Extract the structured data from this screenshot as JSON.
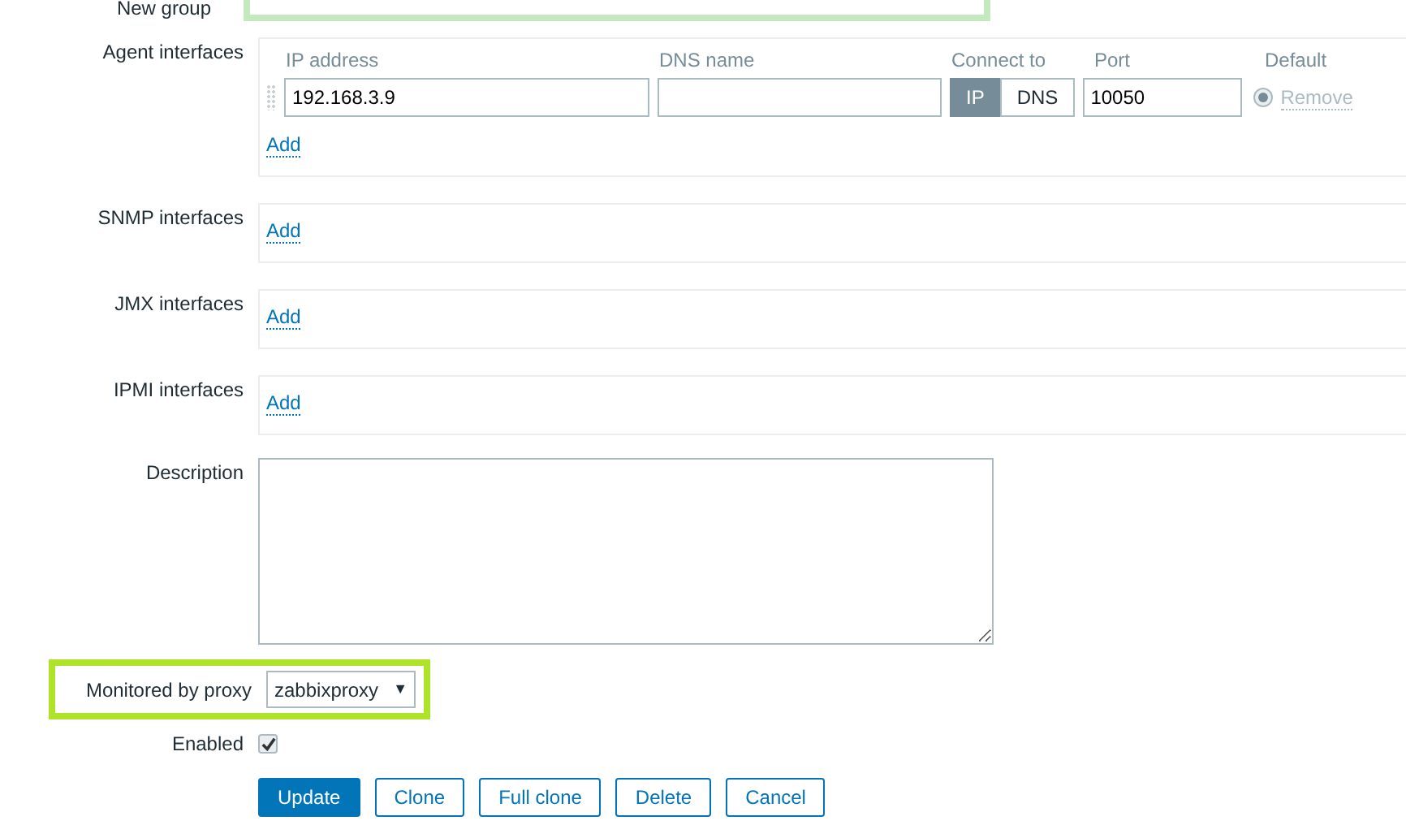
{
  "new_group": {
    "label": "New group"
  },
  "agent_interfaces": {
    "label": "Agent interfaces",
    "columns": [
      "IP address",
      "DNS name",
      "Connect to",
      "Port",
      "Default"
    ],
    "rows": [
      {
        "ip": "192.168.3.9",
        "dns": "",
        "connect": [
          {
            "label": "IP",
            "selected": true
          },
          {
            "label": "DNS",
            "selected": false
          }
        ],
        "port": "10050",
        "default": true,
        "remove": "Remove"
      }
    ],
    "add": "Add"
  },
  "other_interfaces": [
    {
      "label": "SNMP interfaces",
      "add": "Add"
    },
    {
      "label": "JMX interfaces",
      "add": "Add"
    },
    {
      "label": "IPMI interfaces",
      "add": "Add"
    }
  ],
  "description": {
    "label": "Description"
  },
  "proxy": {
    "label": "Monitored by proxy",
    "value": "zabbixproxy",
    "arrow": "▼",
    "highlighted": true
  },
  "enabled": {
    "label": "Enabled",
    "checked": true
  },
  "buttons": [
    {
      "label": "Update",
      "primary": true
    },
    {
      "label": "Clone",
      "primary": false
    },
    {
      "label": "Full clone",
      "primary": false
    },
    {
      "label": "Delete",
      "primary": false
    },
    {
      "label": "Cancel",
      "primary": false
    }
  ]
}
